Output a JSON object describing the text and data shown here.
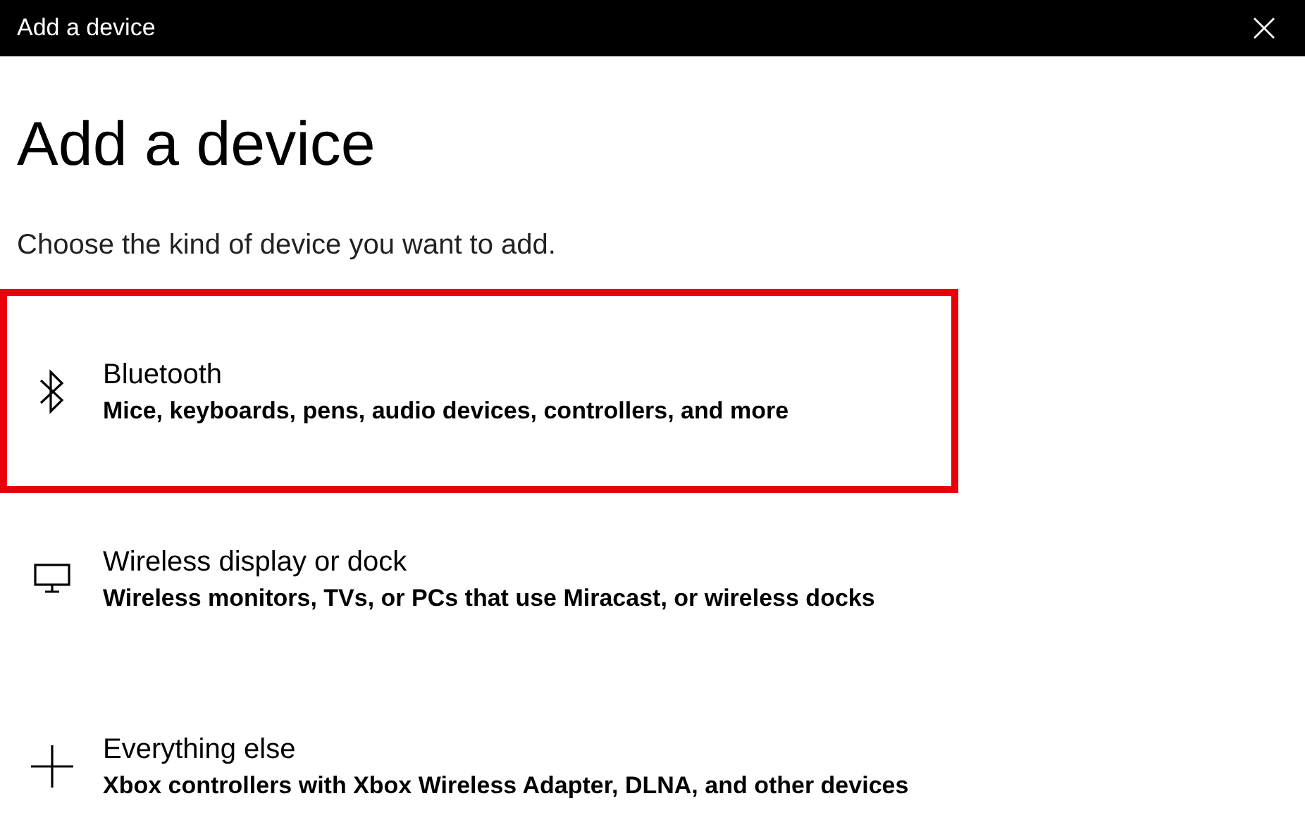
{
  "window": {
    "title": "Add a device"
  },
  "heading": "Add a device",
  "subtitle": "Choose the kind of device you want to add.",
  "options": [
    {
      "kind": "bluetooth",
      "title": "Bluetooth",
      "description": "Mice, keyboards, pens, audio devices, controllers, and more",
      "highlighted": true
    },
    {
      "kind": "display",
      "title": "Wireless display or dock",
      "description": "Wireless monitors, TVs, or PCs that use Miracast, or wireless docks",
      "highlighted": false
    },
    {
      "kind": "other",
      "title": "Everything else",
      "description": "Xbox controllers with Xbox Wireless Adapter, DLNA, and other devices",
      "highlighted": false
    }
  ]
}
